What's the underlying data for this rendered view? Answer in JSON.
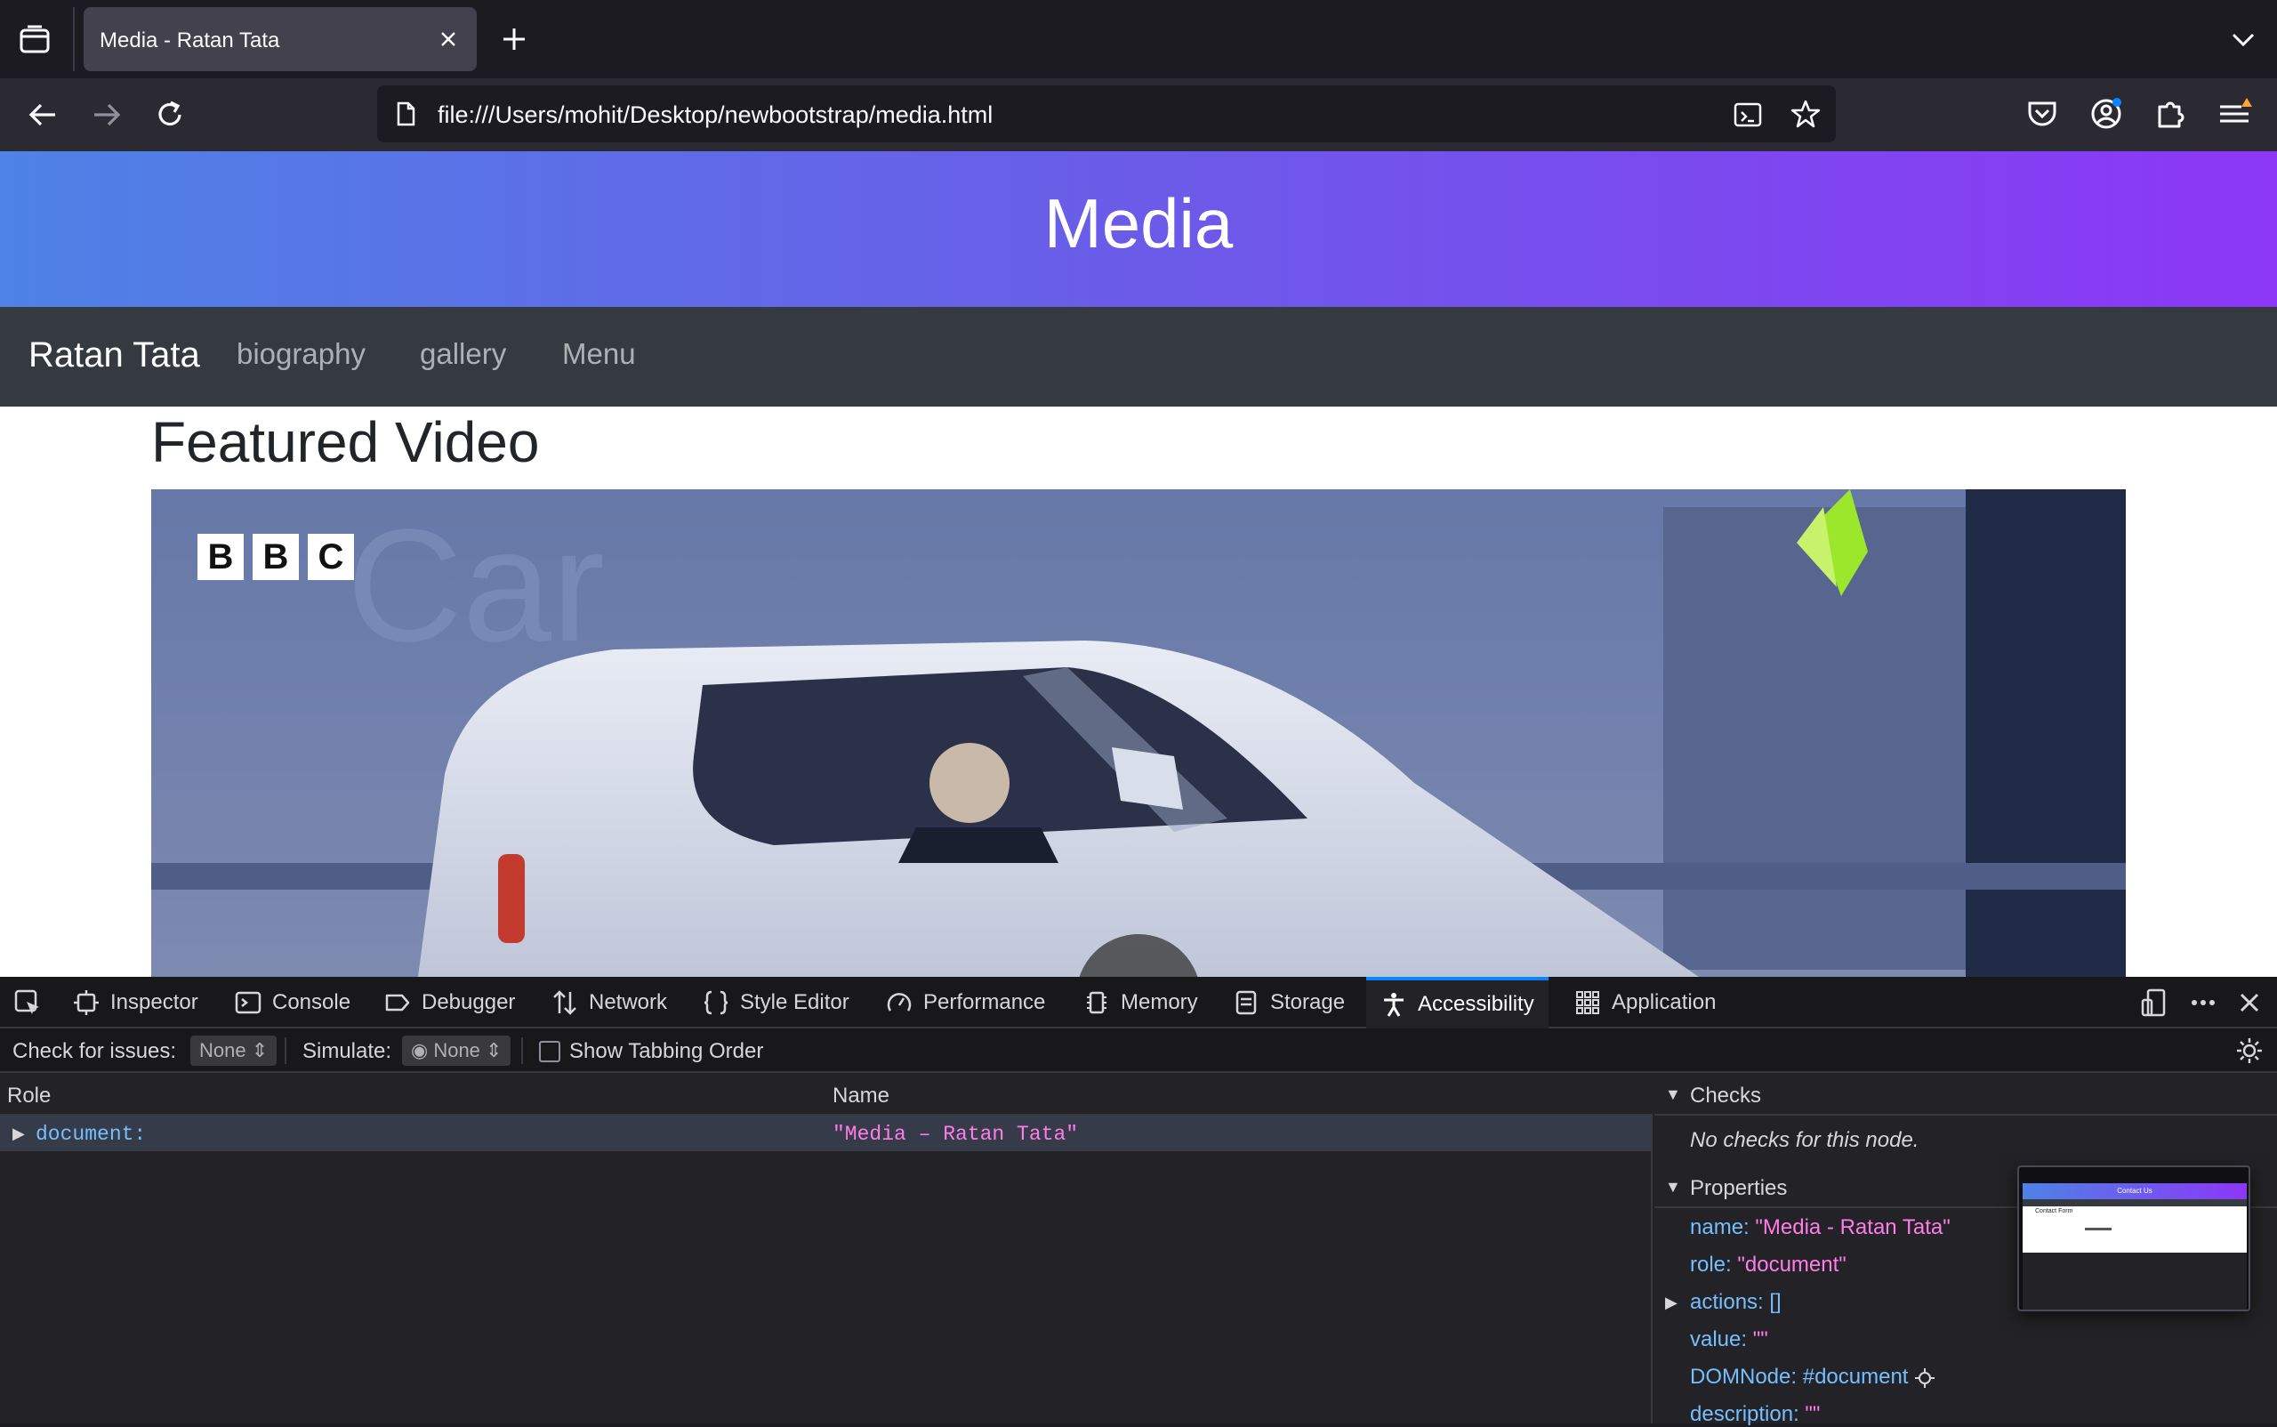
{
  "browser": {
    "tab_title": "Media - Ratan Tata",
    "url": "file:///Users/mohit/Desktop/newbootstrap/media.html"
  },
  "page": {
    "hero_title": "Media",
    "brand": "Ratan Tata",
    "nav_links": [
      "biography",
      "gallery",
      "Menu"
    ],
    "section_title": "Featured Video",
    "video_logo": "BBC",
    "video_watermark": "Car"
  },
  "devtools": {
    "tabs": [
      "Inspector",
      "Console",
      "Debugger",
      "Network",
      "Style Editor",
      "Performance",
      "Memory",
      "Storage",
      "Accessibility",
      "Application"
    ],
    "active_tab": "Accessibility",
    "filter": {
      "check_label": "Check for issues:",
      "check_value": "None",
      "simulate_label": "Simulate:",
      "simulate_value": "None",
      "tabbing_label": "Show Tabbing Order"
    },
    "tree": {
      "col_role": "Role",
      "col_name": "Name",
      "row_role": "document:",
      "row_name": "\"Media – Ratan Tata\""
    },
    "sidebar": {
      "checks_title": "Checks",
      "checks_text": "No checks for this node.",
      "properties_title": "Properties",
      "props": [
        {
          "key": "name:",
          "value": "\"Media - Ratan Tata\""
        },
        {
          "key": "role:",
          "value": "\"document\""
        },
        {
          "key": "actions:",
          "value": "[]"
        },
        {
          "key": "value:",
          "value": "\"\""
        },
        {
          "key": "DOMNode:",
          "value": "#document"
        },
        {
          "key": "description:",
          "value": "\"\""
        }
      ]
    },
    "thumbnail": {
      "title": "Contact Us",
      "subtitle": "Contact Form"
    }
  },
  "colors": {
    "accent": "#0a84ff",
    "hero_start": "#4e82e6",
    "hero_end": "#8c37f6",
    "navbar_dark": "#343a40"
  }
}
